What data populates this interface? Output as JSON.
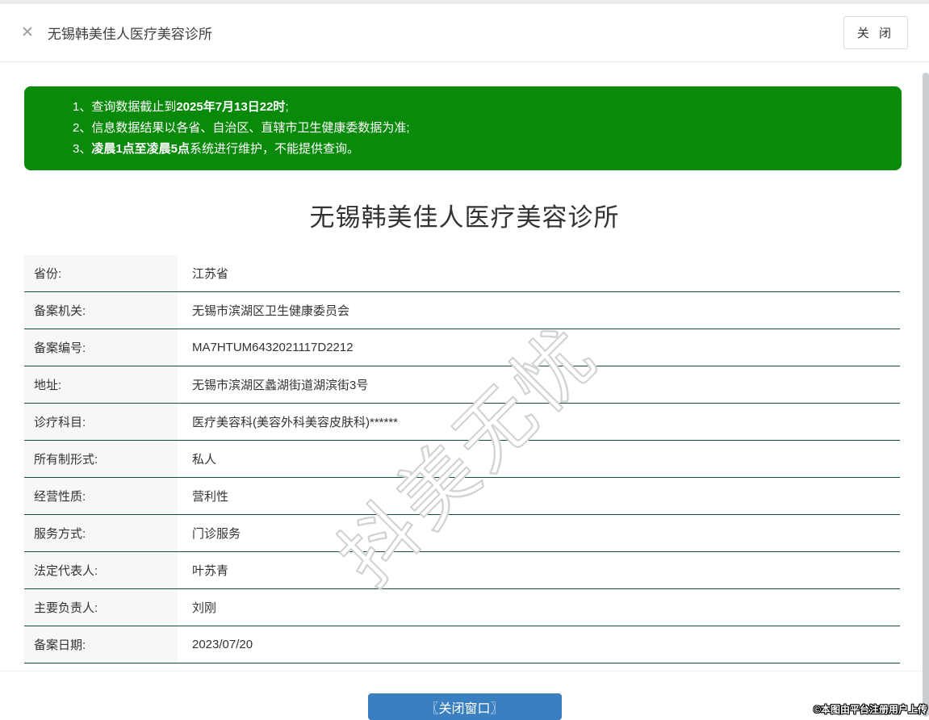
{
  "header": {
    "title": "无锡韩美佳人医疗美容诊所",
    "close_button_label": "关 闭"
  },
  "icons": {
    "close": "✕"
  },
  "notice": {
    "lines": [
      {
        "pre": "1、查询数据截止到",
        "bold": "2025年7月13日22时",
        "post": ";"
      },
      {
        "pre": "2、信息数据结果以各省、自治区、直辖市卫生健康委数据为准;",
        "bold": "",
        "post": ""
      },
      {
        "pre": "3、",
        "bold": "凌晨1点至凌晨5点",
        "post": "系统进行维护，不能提供查询。"
      }
    ]
  },
  "main": {
    "title": "无锡韩美佳人医疗美容诊所"
  },
  "table": {
    "rows": [
      {
        "label": "省份:",
        "value": "江苏省"
      },
      {
        "label": "备案机关:",
        "value": "无锡市滨湖区卫生健康委员会"
      },
      {
        "label": "备案编号:",
        "value": "MA7HTUM6432021117D2212"
      },
      {
        "label": "地址:",
        "value": "无锡市滨湖区蠡湖街道湖滨街3号"
      },
      {
        "label": "诊疗科目:",
        "value": "医疗美容科(美容外科美容皮肤科)******"
      },
      {
        "label": "所有制形式:",
        "value": "私人"
      },
      {
        "label": "经营性质:",
        "value": "营利性"
      },
      {
        "label": "服务方式:",
        "value": "门诊服务"
      },
      {
        "label": "法定代表人:",
        "value": "叶苏青"
      },
      {
        "label": "主要负责人:",
        "value": "刘刚"
      },
      {
        "label": "备案日期:",
        "value": "2023/07/20"
      }
    ]
  },
  "footer": {
    "close_window_button_label": "〖关闭窗口〗"
  },
  "watermark": {
    "text": "抖美无忧"
  },
  "copyright": {
    "text": "©本图由平台注册用户上传"
  },
  "colors": {
    "notice_bg": "#0a8a0a",
    "table_divider": "#15503e",
    "button_blue": "#3a80c1",
    "label_cell_bg": "#f7f7f7"
  }
}
